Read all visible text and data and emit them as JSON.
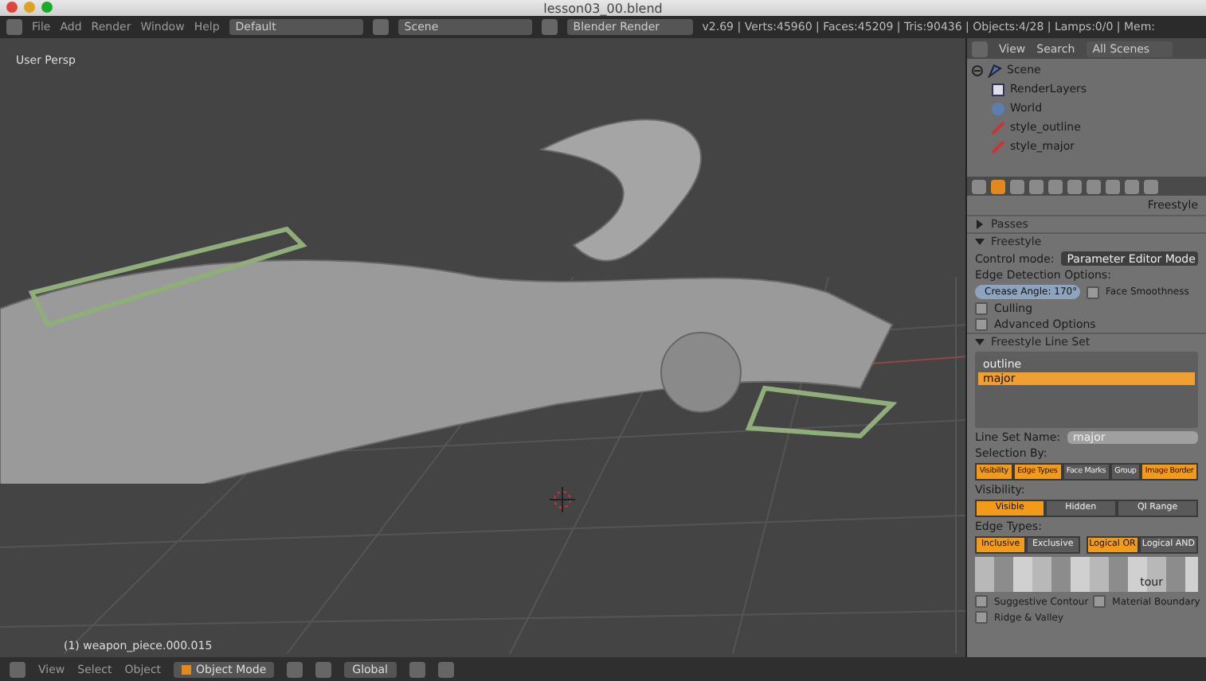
{
  "window": {
    "title": "lesson03_00.blend"
  },
  "menu_bar": {
    "menus": [
      "File",
      "Add",
      "Render",
      "Window",
      "Help"
    ],
    "layout": "Default",
    "scene": "Scene",
    "engine": "Blender Render",
    "stats": "v2.69 | Verts:45960 | Faces:45209 | Tris:90436 | Objects:4/28 | Lamps:0/0 | Mem:"
  },
  "viewport": {
    "label": "User Persp",
    "object_info": "(1) weapon_piece.000.015"
  },
  "outliner": {
    "menus": [
      "View",
      "Search"
    ],
    "filter": "All Scenes",
    "tree": [
      {
        "label": "Scene",
        "kind": "scene",
        "expanded": true,
        "children": [
          {
            "label": "RenderLayers",
            "kind": "layers"
          },
          {
            "label": "World",
            "kind": "world"
          },
          {
            "label": "style_outline",
            "kind": "style"
          },
          {
            "label": "style_major",
            "kind": "style"
          }
        ]
      }
    ]
  },
  "properties": {
    "tabs": [
      {
        "selected": false
      },
      {
        "selected": true
      },
      {
        "selected": false
      },
      {
        "selected": false
      },
      {
        "selected": false
      },
      {
        "selected": false
      },
      {
        "selected": false
      },
      {
        "selected": false
      },
      {
        "selected": false
      },
      {
        "selected": false
      }
    ],
    "context": "Freestyle",
    "passes": {
      "title": "Passes",
      "expanded": false
    },
    "freestyle": {
      "title": "Freestyle",
      "expanded": true,
      "control_mode_label": "Control mode:",
      "control_mode": "Parameter Editor Mode",
      "edge_options_label": "Edge Detection Options:",
      "crease": "Crease Angle: 170°",
      "face_smoothness": {
        "label": "Face Smoothness",
        "checked": false
      },
      "culling": {
        "label": "Culling",
        "checked": false
      },
      "advanced": {
        "label": "Advanced Options",
        "checked": false
      }
    },
    "line_set": {
      "title": "Freestyle Line Set",
      "expanded": true,
      "items": [
        {
          "name": "outline",
          "selected": false
        },
        {
          "name": "major",
          "selected": true
        }
      ],
      "name_label": "Line Set Name:",
      "name": "major",
      "selection_label": "Selection By:",
      "selection": [
        {
          "label": "Visibility",
          "on": true
        },
        {
          "label": "Edge Types",
          "on": true
        },
        {
          "label": "Face Marks",
          "on": false
        },
        {
          "label": "Group",
          "on": false
        },
        {
          "label": "Image Border",
          "on": true
        }
      ],
      "visibility_label": "Visibility:",
      "visibility": [
        {
          "label": "Visible",
          "selected": true
        },
        {
          "label": "Hidden",
          "selected": false
        },
        {
          "label": "QI Range",
          "selected": false
        }
      ],
      "edge_types_label": "Edge Types:",
      "inclusion": [
        {
          "label": "Inclusive",
          "selected": true
        },
        {
          "label": "Exclusive",
          "selected": false
        }
      ],
      "logic": [
        {
          "label": "Logical OR",
          "selected": true
        },
        {
          "label": "Logical AND",
          "selected": false
        }
      ],
      "partial_text": "tour",
      "edge_checks": [
        {
          "label": "Suggestive Contour",
          "checked": false
        },
        {
          "label": "Material Boundary",
          "checked": false
        },
        {
          "label": "Ridge & Valley",
          "checked": false
        }
      ]
    }
  },
  "bottom_bar": {
    "menus": [
      "View",
      "Select",
      "Object"
    ],
    "mode": "Object Mode",
    "orientation": "Global"
  }
}
